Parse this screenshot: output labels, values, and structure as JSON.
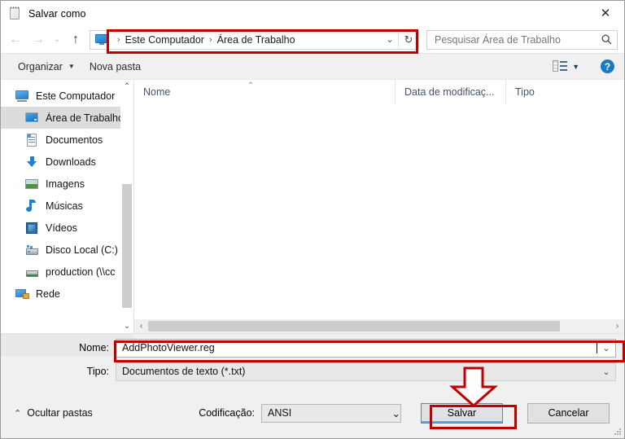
{
  "window": {
    "title": "Salvar como",
    "title_icon": "notepad-icon",
    "close_label": "✕"
  },
  "nav": {
    "back_icon": "←",
    "forward_icon": "→",
    "recent_icon": "⌄",
    "up_icon": "↑",
    "breadcrumb": {
      "icon": "desktop-icon",
      "separator": "›",
      "items": [
        "Este Computador",
        "Área de Trabalho"
      ],
      "dropdown_icon": "⌄",
      "refresh_icon": "↻"
    },
    "search": {
      "placeholder": "Pesquisar Área de Trabalho",
      "icon": "⌕"
    }
  },
  "toolbar": {
    "organize_label": "Organizar",
    "organize_caret": "▼",
    "new_folder_label": "Nova pasta",
    "view_caret": "▼",
    "help_label": "?"
  },
  "sidebar": {
    "items": [
      {
        "label": "Este Computador",
        "icon": "pc-icon",
        "level": 0,
        "selected": false
      },
      {
        "label": "Área de Trabalho",
        "icon": "desktop-icon",
        "level": 1,
        "selected": true
      },
      {
        "label": "Documentos",
        "icon": "documents-icon",
        "level": 1,
        "selected": false
      },
      {
        "label": "Downloads",
        "icon": "downloads-icon",
        "level": 1,
        "selected": false
      },
      {
        "label": "Imagens",
        "icon": "pictures-icon",
        "level": 1,
        "selected": false
      },
      {
        "label": "Músicas",
        "icon": "music-icon",
        "level": 1,
        "selected": false
      },
      {
        "label": "Vídeos",
        "icon": "videos-icon",
        "level": 1,
        "selected": false
      },
      {
        "label": "Disco Local (C:)",
        "icon": "local-disk-icon",
        "level": 1,
        "selected": false
      },
      {
        "label": "production (\\\\cc",
        "icon": "network-drive-icon",
        "level": 1,
        "selected": false
      },
      {
        "label": "Rede",
        "icon": "network-icon",
        "level": 0,
        "selected": false
      }
    ],
    "scroll_up_icon": "⌃",
    "scroll_down_icon": "⌄"
  },
  "filelist": {
    "columns": [
      "Nome",
      "Data de modificaç...",
      "Tipo"
    ],
    "sort_caret": "⌃",
    "rows": [],
    "hscroll": {
      "left_icon": "‹",
      "right_icon": "›"
    }
  },
  "form": {
    "name_label": "Nome:",
    "name_value": "AddPhotoViewer.reg",
    "name_dropdown_icon": "⌄",
    "type_label": "Tipo:",
    "type_value": "Documentos de texto (*.txt)",
    "type_dropdown_icon": "⌄",
    "hide_folders_label": "Ocultar pastas",
    "hide_folders_caret": "⌃",
    "encoding_label": "Codificação:",
    "encoding_value": "ANSI",
    "encoding_dropdown_icon": "⌄",
    "save_label": "Salvar",
    "cancel_label": "Cancelar"
  },
  "annotations": {
    "accent_color": "#c00000",
    "highlighted": [
      "breadcrumb-bar",
      "name-input",
      "save-button"
    ],
    "arrow": "down-arrow-to-save-button"
  }
}
